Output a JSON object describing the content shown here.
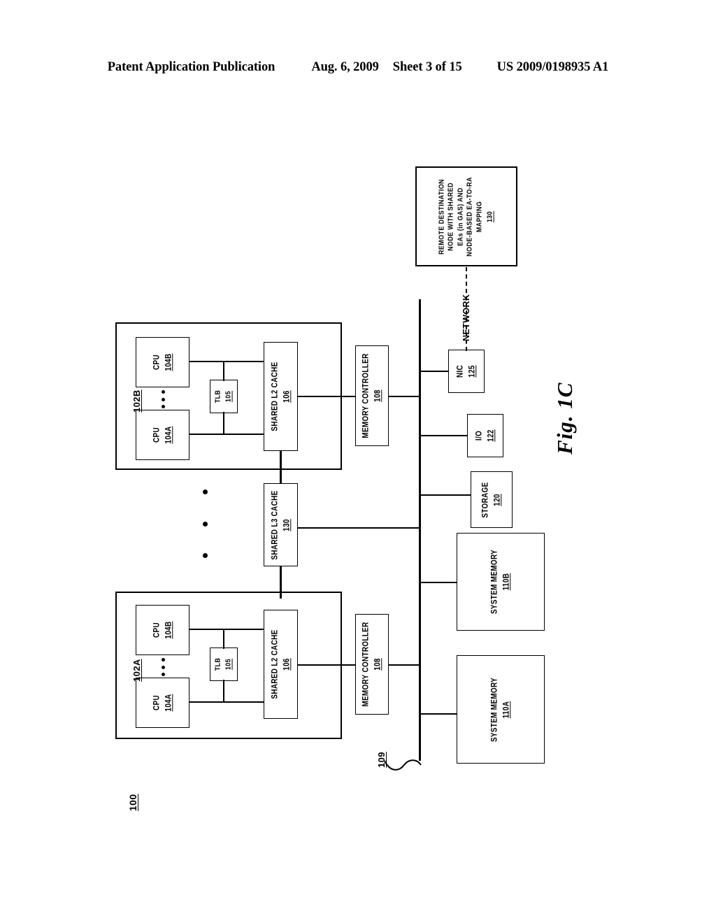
{
  "header": {
    "publication": "Patent Application Publication",
    "date": "Aug. 6, 2009",
    "sheet": "Sheet 3 of 15",
    "number": "US 2009/0198935 A1"
  },
  "figure": {
    "caption": "Fig. 1C",
    "system_ref": "100",
    "bus_ref": "109",
    "network_label": "NETWORK"
  },
  "blocks": {
    "remote_node": {
      "lines": [
        "REMOTE DESTINATION",
        "NODE WITH SHARED",
        "EAs (in GAS) AND",
        "NODE-BASED EA-TO-RA",
        "MAPPING"
      ],
      "ref": "130"
    },
    "chip_b": {
      "ref": "102B"
    },
    "chip_a": {
      "ref": "102A"
    },
    "cpu_b_upper": {
      "label": "CPU",
      "ref": "104B"
    },
    "cpu_a_upper": {
      "label": "CPU",
      "ref": "104A"
    },
    "cpu_b_lower": {
      "label": "CPU",
      "ref": "104B"
    },
    "cpu_a_lower": {
      "label": "CPU",
      "ref": "104A"
    },
    "tlb_upper": {
      "label": "TLB",
      "ref": "105"
    },
    "tlb_lower": {
      "label": "TLB",
      "ref": "105"
    },
    "l2_upper": {
      "label": "SHARED L2 CACHE",
      "ref": "106"
    },
    "l2_lower": {
      "label": "SHARED L2 CACHE",
      "ref": "106"
    },
    "l3": {
      "label": "SHARED L3 CACHE",
      "ref": "130"
    },
    "memctrl_upper": {
      "label": "MEMORY CONTROLLER",
      "ref": "108"
    },
    "memctrl_lower": {
      "label": "MEMORY CONTROLLER",
      "ref": "108"
    },
    "nic": {
      "label": "NIC",
      "ref": "125"
    },
    "io": {
      "label": "I/O",
      "ref": "122"
    },
    "storage": {
      "label": "STORAGE",
      "ref": "120"
    },
    "sysmem_b": {
      "label": "SYSTEM MEMORY",
      "ref": "110B"
    },
    "sysmem_a": {
      "label": "SYSTEM MEMORY",
      "ref": "110A"
    }
  }
}
